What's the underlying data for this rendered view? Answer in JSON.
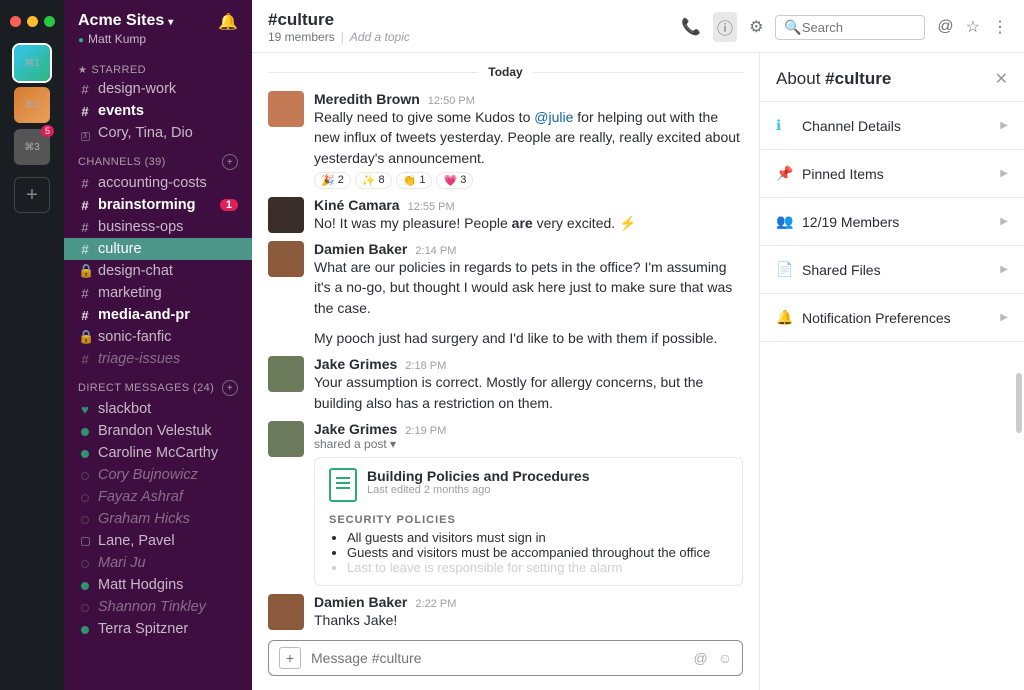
{
  "workspace": {
    "name": "Acme Sites",
    "user": "Matt Kump"
  },
  "rail": {
    "items": [
      {
        "label": "⌘1",
        "color": "linear-gradient(135deg,#36c5f0,#2eb67d)",
        "selected": true
      },
      {
        "label": "⌘2",
        "color": "linear-gradient(135deg,#d97b34,#e6a15a)"
      },
      {
        "label": "⌘3",
        "color": "#555",
        "badge": "5"
      }
    ]
  },
  "sidebar": {
    "starred_label": "STARRED",
    "starred": [
      {
        "prefix": "#",
        "name": "design-work",
        "bold": false
      },
      {
        "prefix": "#",
        "name": "events",
        "bold": true
      },
      {
        "prefix": "sq",
        "name": "Cory, Tina, Dio",
        "bold": false,
        "count": "3"
      }
    ],
    "channels_label": "CHANNELS",
    "channels_count": "(39)",
    "channels": [
      {
        "prefix": "#",
        "name": "accounting-costs"
      },
      {
        "prefix": "#",
        "name": "brainstorming",
        "bold": true,
        "badge": "1"
      },
      {
        "prefix": "#",
        "name": "business-ops"
      },
      {
        "prefix": "#",
        "name": "culture",
        "active": true
      },
      {
        "prefix": "lock",
        "name": "design-chat"
      },
      {
        "prefix": "#",
        "name": "marketing"
      },
      {
        "prefix": "#",
        "name": "media-and-pr",
        "bold": true
      },
      {
        "prefix": "lock",
        "name": "sonic-fanfic"
      },
      {
        "prefix": "#",
        "name": "triage-issues",
        "muted": true
      }
    ],
    "dm_label": "DIRECT MESSAGES",
    "dm_count": "(24)",
    "dms": [
      {
        "name": "slackbot",
        "heart": true,
        "presence": "on"
      },
      {
        "name": "Brandon Velestuk",
        "presence": "on"
      },
      {
        "name": "Caroline McCarthy",
        "presence": "on"
      },
      {
        "name": "Cory Bujnowicz",
        "presence": "off",
        "muted": true
      },
      {
        "name": "Fayaz Ashraf",
        "presence": "off",
        "muted": true
      },
      {
        "name": "Graham Hicks",
        "presence": "off",
        "muted": true
      },
      {
        "name": "Lane, Pavel",
        "presence": "sq",
        "count": "2"
      },
      {
        "name": "Mari Ju",
        "presence": "off",
        "muted": true
      },
      {
        "name": "Matt Hodgins",
        "presence": "on"
      },
      {
        "name": "Shannon Tinkley",
        "presence": "off",
        "muted": true
      },
      {
        "name": "Terra Spitzner",
        "presence": "on"
      }
    ]
  },
  "channel": {
    "name": "#culture",
    "members": "19 members",
    "topic": "Add a topic",
    "search_placeholder": "Search",
    "divider": "Today"
  },
  "messages": [
    {
      "author": "Meredith Brown",
      "ts": "12:50 PM",
      "ava": "#c47a54",
      "body_pre": "Really need to give some Kudos to ",
      "mention": "@julie",
      "body_post": " for helping out with the new influx of tweets yesterday. People are really, really excited about yesterday's announcement.",
      "reactions": [
        {
          "e": "🎉",
          "n": "2"
        },
        {
          "e": "✨",
          "n": "8"
        },
        {
          "e": "👏",
          "n": "1"
        },
        {
          "e": "💗",
          "n": "3"
        }
      ]
    },
    {
      "author": "Kiné Camara",
      "ts": "12:55 PM",
      "ava": "#3a2d2a",
      "body_pre": "No! It was my pleasure! People ",
      "bold": "are",
      "body_post": " very excited. ",
      "bolt": "⚡"
    },
    {
      "author": "Damien Baker",
      "ts": "2:14 PM",
      "ava": "#8b5a3c",
      "body": "What are our policies in regards to pets in the office? I'm assuming it's a no-go, but thought I would ask here just to make sure that was the case.",
      "body2": "My pooch just had surgery and I'd like to be with them if possible."
    },
    {
      "author": "Jake Grimes",
      "ts": "2:18 PM",
      "ava": "#6b7a5a",
      "body": "Your assumption is correct. Mostly for allergy concerns, but the building also has a restriction on them."
    },
    {
      "author": "Jake Grimes",
      "ts": "2:19 PM",
      "ava": "#6b7a5a",
      "sub": "shared a post ▾",
      "post": {
        "title": "Building Policies and Procedures",
        "edited": "Last edited 2 months ago",
        "section": "SECURITY POLICIES",
        "bullets": [
          "All guests and visitors must sign in",
          "Guests and visitors must be accompanied throughout the office",
          "Last to leave is responsible for setting the alarm"
        ]
      }
    },
    {
      "author": "Damien Baker",
      "ts": "2:22 PM",
      "ava": "#8b5a3c",
      "body": "Thanks Jake!"
    }
  ],
  "composer": {
    "placeholder": "Message #culture"
  },
  "details": {
    "title_pre": "About ",
    "title_name": "#culture",
    "rows": [
      {
        "icon": "ℹ",
        "color": "c-blue",
        "label": "Channel Details"
      },
      {
        "icon": "📌",
        "color": "c-red",
        "label": "Pinned Items"
      },
      {
        "icon": "👥",
        "color": "c-green",
        "label": "12/19 Members"
      },
      {
        "icon": "📄",
        "color": "c-yellow",
        "label": "Shared Files"
      },
      {
        "icon": "🔔",
        "color": "c-orange",
        "label": "Notification Preferences"
      }
    ]
  }
}
